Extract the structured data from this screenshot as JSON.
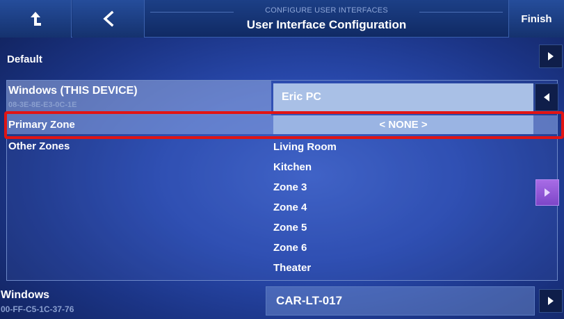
{
  "header": {
    "subtitle": "CONFIGURE USER INTERFACES",
    "title": "User Interface Configuration",
    "finish_label": "Finish"
  },
  "default_row": {
    "label": "Default"
  },
  "device_this": {
    "label": "Windows (THIS DEVICE)",
    "mac": "08-3E-8E-E3-0C-1E",
    "value": "Eric PC"
  },
  "primary_zone": {
    "label": "Primary Zone",
    "value": "< NONE >"
  },
  "other_zones": {
    "label": "Other Zones",
    "items": [
      "Living Room",
      "Kitchen",
      "Zone 3",
      "Zone 4",
      "Zone 5",
      "Zone 6",
      "Theater"
    ]
  },
  "device_other": {
    "label": "Windows",
    "mac": "00-FF-C5-1C-37-76",
    "value": "CAR-LT-017"
  },
  "colors": {
    "highlight": "#e11414",
    "accent_purple": "#a86ce6"
  }
}
